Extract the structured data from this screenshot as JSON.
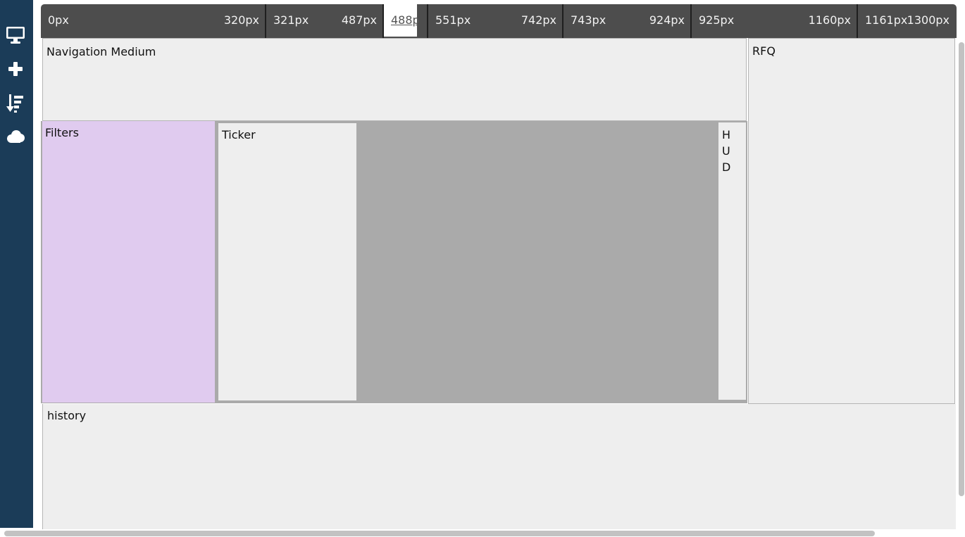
{
  "sidebar": {
    "icons": [
      {
        "name": "desktop-icon"
      },
      {
        "name": "plus-icon"
      },
      {
        "name": "sort-icon"
      },
      {
        "name": "cloud-icon"
      }
    ]
  },
  "ruler": {
    "segments": [
      {
        "lo": "0px",
        "hi": "320px"
      },
      {
        "lo": "321px",
        "hi": "487px"
      },
      {
        "lo": "488p",
        "hi": ""
      },
      {
        "lo": "551px",
        "hi": "742px"
      },
      {
        "lo": "743px",
        "hi": "924px"
      },
      {
        "lo": "925px",
        "hi": "1160px"
      },
      {
        "lo": "1161px",
        "hi": "1300px"
      }
    ]
  },
  "panels": {
    "navigation": "Navigation Medium",
    "rfq": "RFQ",
    "filters": "Filters",
    "ticker": "Ticker",
    "hud": "HUD",
    "history": "history"
  },
  "colors": {
    "sidebar": "#1b3c58",
    "ruler": "#4d4d4d",
    "panel": "#eeeeee",
    "filters": "#e0cbef",
    "gap": "#aaaaaa"
  }
}
